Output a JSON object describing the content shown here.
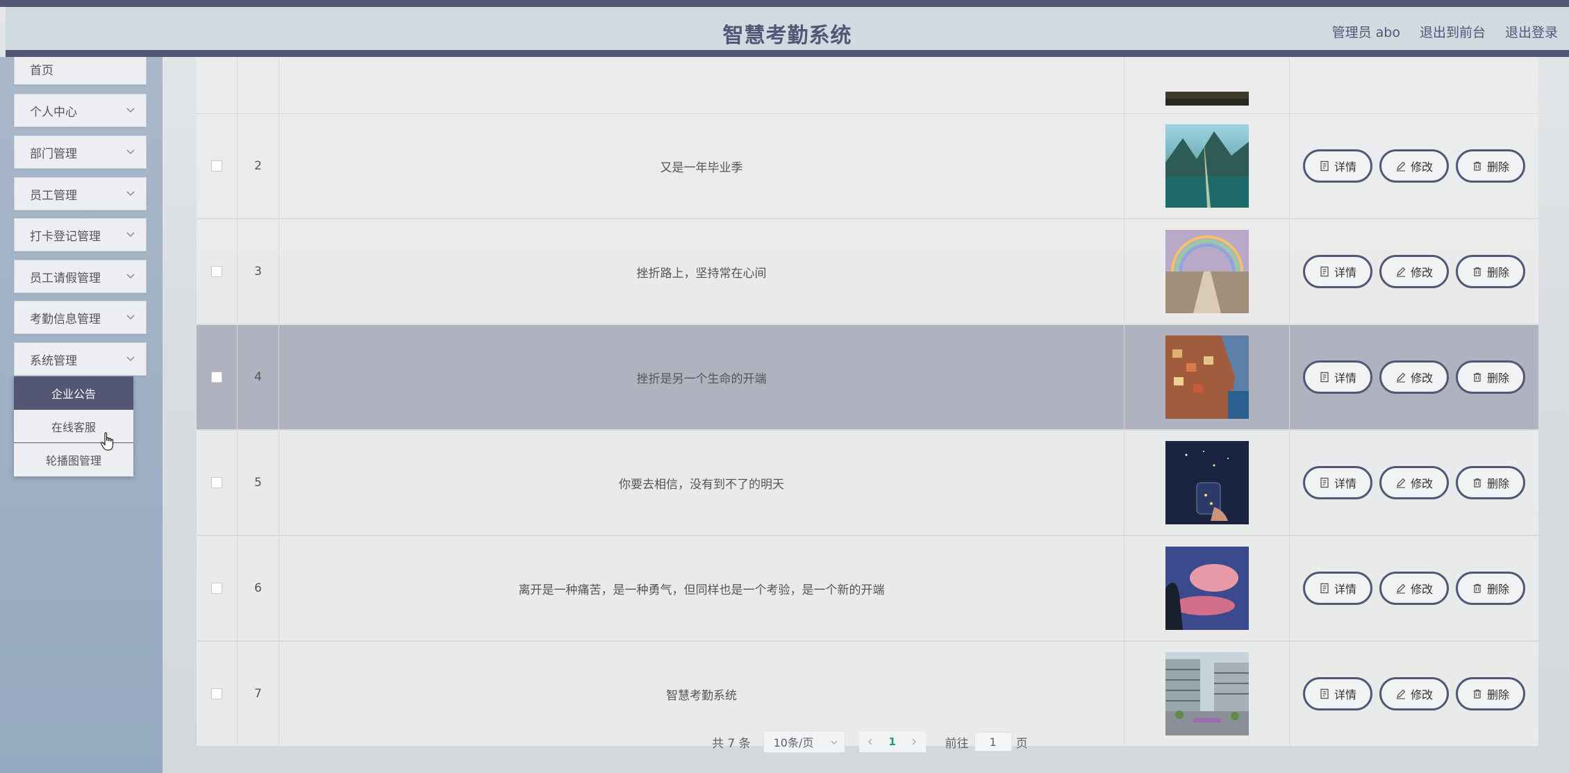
{
  "header": {
    "title": "智慧考勤系统",
    "user": "管理员 abo",
    "to_front": "退出到前台",
    "logout": "退出登录"
  },
  "sidebar": {
    "items": [
      {
        "label": "首页",
        "has_arrow": false
      },
      {
        "label": "个人中心",
        "has_arrow": true
      },
      {
        "label": "部门管理",
        "has_arrow": true
      },
      {
        "label": "员工管理",
        "has_arrow": true
      },
      {
        "label": "打卡登记管理",
        "has_arrow": true
      },
      {
        "label": "员工请假管理",
        "has_arrow": true
      },
      {
        "label": "考勤信息管理",
        "has_arrow": true
      },
      {
        "label": "系统管理",
        "has_arrow": true
      }
    ],
    "submenu": [
      {
        "label": "企业公告",
        "active": true
      },
      {
        "label": "在线客服",
        "active": false
      },
      {
        "label": "轮播图管理",
        "active": false
      }
    ]
  },
  "table": {
    "rows": [
      {
        "num": "2",
        "title": "又是一年毕业季",
        "image": "lake-mountains",
        "highlighted": false
      },
      {
        "num": "3",
        "title": "挫折路上，坚持常在心间",
        "image": "rainbow-path",
        "highlighted": false
      },
      {
        "num": "4",
        "title": "挫折是另一个生命的开端",
        "image": "coastal-village",
        "highlighted": true
      },
      {
        "num": "5",
        "title": "你要去相信，没有到不了的明天",
        "image": "jar-of-stars",
        "highlighted": false
      },
      {
        "num": "6",
        "title": "离开是一种痛苦，是一种勇气，但同样也是一个考验，是一个新的开端",
        "image": "pink-cloud",
        "highlighted": false
      },
      {
        "num": "7",
        "title": "智慧考勤系统",
        "image": "campus-building",
        "highlighted": false
      }
    ],
    "actions": {
      "detail": "详情",
      "edit": "修改",
      "delete": "删除"
    }
  },
  "pagination": {
    "total": "共 7 条",
    "page_size": "10条/页",
    "current_page": "1",
    "goto_label": "前往",
    "goto_value": "1",
    "page_suffix": "页"
  }
}
